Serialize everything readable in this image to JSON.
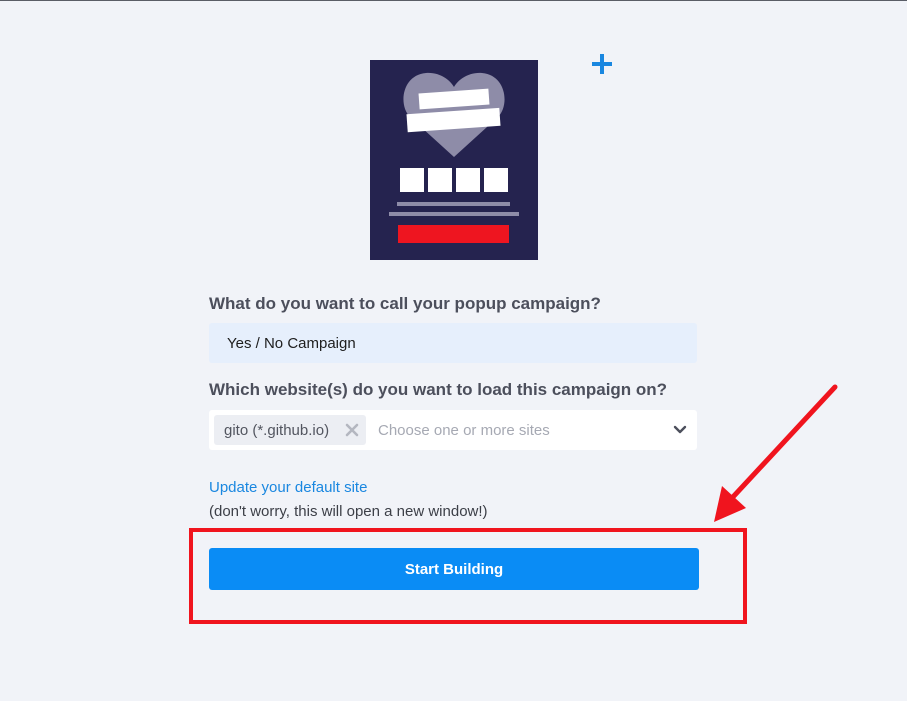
{
  "form": {
    "name_label": "What do you want to call your popup campaign?",
    "name_value": "Yes / No Campaign",
    "sites_label": "Which website(s) do you want to load this campaign on?",
    "selected_site": "gito (*.github.io)",
    "sites_placeholder": "Choose one or more sites",
    "update_link": "Update your default site",
    "update_note": "(don't worry, this will open a new window!)",
    "submit_label": "Start Building"
  },
  "icons": {
    "illustration": "popup-template-illustration",
    "plus": "plus-icon",
    "chip_remove": "close-icon",
    "dropdown": "chevron-down-icon",
    "annotation": "red-arrow"
  },
  "colors": {
    "accent": "#0a8cf5",
    "link": "#1a87e0",
    "background": "#f1f3f8",
    "input_bg": "#e6effc",
    "illustration_bg": "#25234f",
    "annotation": "#f0141e"
  }
}
